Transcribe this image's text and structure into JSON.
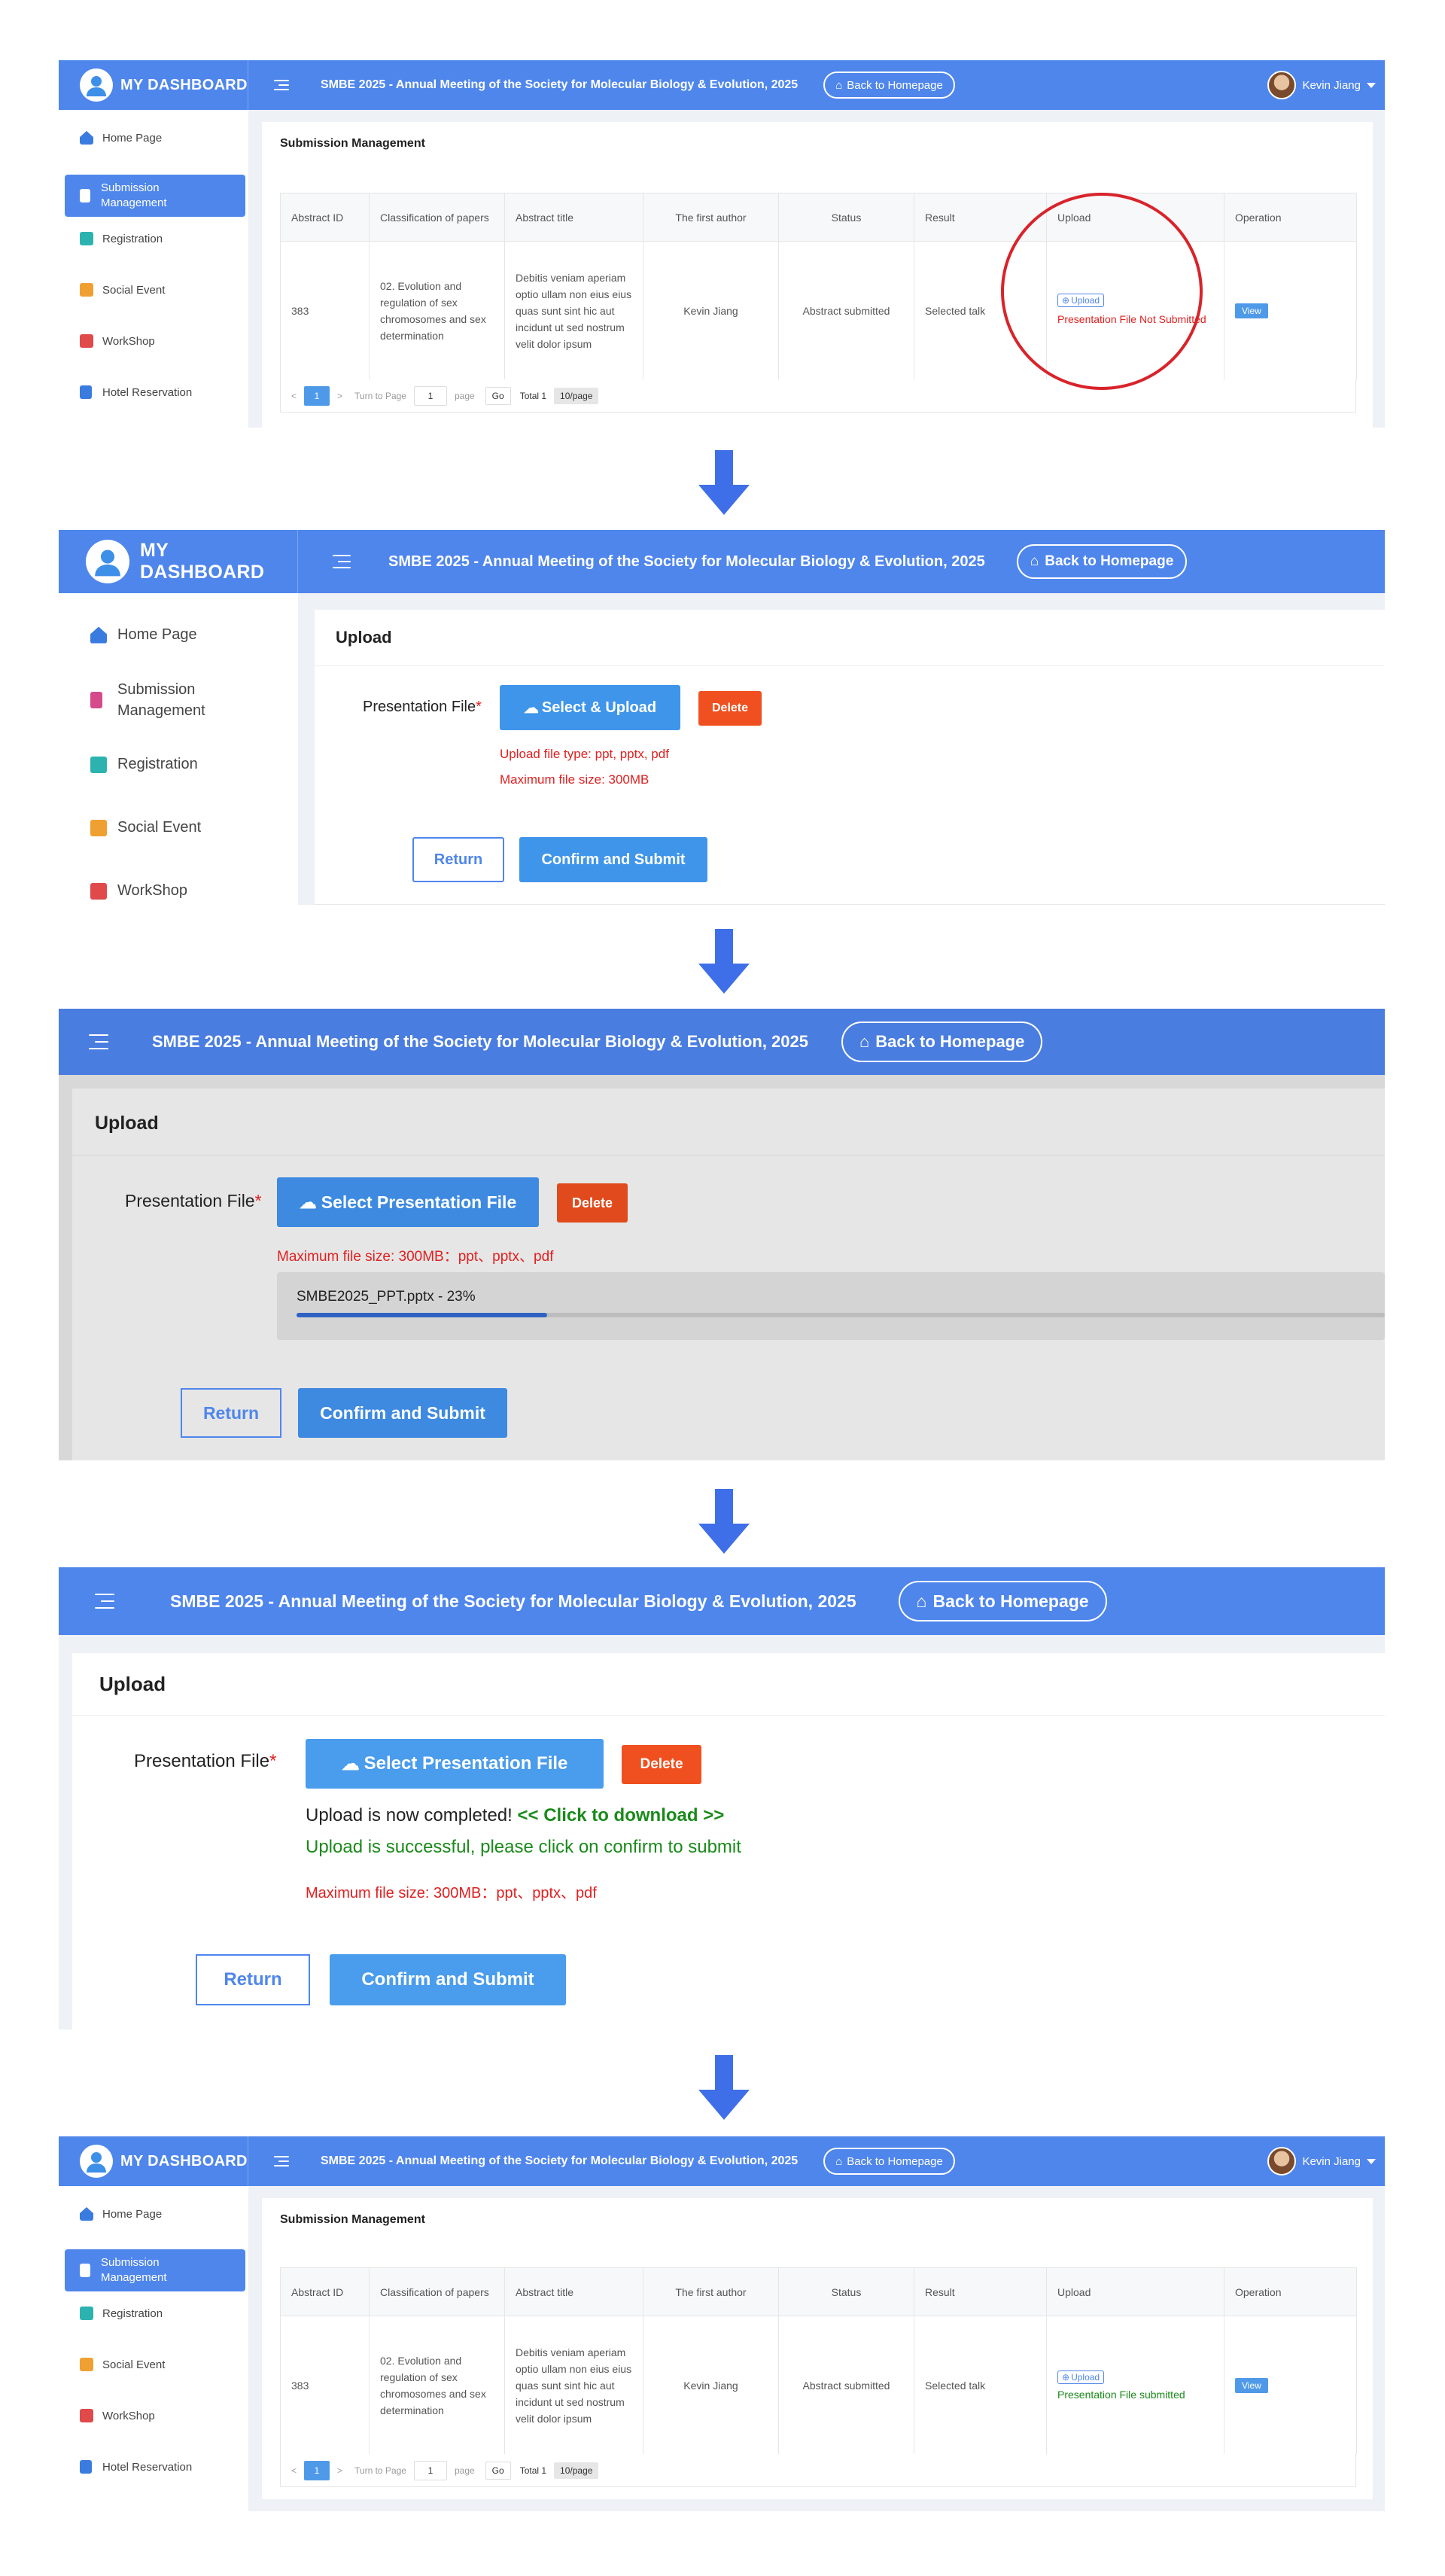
{
  "app": {
    "brand": "MY DASHBOARD",
    "conference_title": "SMBE 2025 - Annual Meeting of the Society for Molecular Biology & Evolution, 2025",
    "back_home": "Back to Homepage",
    "user_name": "Kevin Jiang"
  },
  "sidebar": {
    "items": [
      {
        "label": "Home Page",
        "color": "#3a7be0"
      },
      {
        "label": "Submission Management",
        "color": "#d44a8a"
      },
      {
        "label": "Registration",
        "color": "#2cb3b0"
      },
      {
        "label": "Social Event",
        "color": "#f0a030"
      },
      {
        "label": "WorkShop",
        "color": "#e04a4a"
      },
      {
        "label": "Hotel Reservation",
        "color": "#3a7be0"
      }
    ]
  },
  "submission": {
    "title": "Submission Management",
    "headers": [
      "Abstract ID",
      "Classification of papers",
      "Abstract title",
      "The first author",
      "Status",
      "Result",
      "Upload",
      "Operation"
    ],
    "row": {
      "id": "383",
      "classification": "02. Evolution and regulation of sex chromosomes and sex determination",
      "abstract_title": "Debitis veniam aperiam optio ullam non eius eius quas sunt sint hic aut incidunt ut sed nostrum velit dolor ipsum",
      "author": "Kevin Jiang",
      "status": "Abstract submitted",
      "result": "Selected talk",
      "upload_button": "Upload",
      "upload_status_before": "Presentation File Not Submitted",
      "upload_status_after": "Presentation File submitted",
      "operation": "View"
    },
    "pager": {
      "page": "1",
      "turn_to": "Turn to Page",
      "page_input": "1",
      "page_word": "page",
      "go": "Go",
      "total": "Total 1",
      "page_size": "10/page"
    }
  },
  "upload": {
    "title": "Upload",
    "field_label": "Presentation File",
    "required_mark": "*",
    "select_upload": "Select & Upload",
    "select_file": "Select Presentation File",
    "delete": "Delete",
    "allowed_types": "Upload file type: ppt, pptx, pdf",
    "max_size": "Maximum file size: 300MB",
    "max_size_combined": "Maximum file size: 300MB：ppt、pptx、pdf",
    "progress_text": "SMBE2025_PPT.pptx - 23%",
    "progress": 0.23,
    "completed_text": "Upload is now completed!",
    "download_link": "<< Click to download >>",
    "success_text": "Upload is successful, please click on confirm to submit",
    "return": "Return",
    "confirm": "Confirm and Submit"
  },
  "colors": {
    "accent": "#4f86ec",
    "button": "#3f95ea",
    "delete": "#f0501f",
    "error": "#e02020",
    "success": "#1a8a1a",
    "annotation": "#d9232a"
  }
}
